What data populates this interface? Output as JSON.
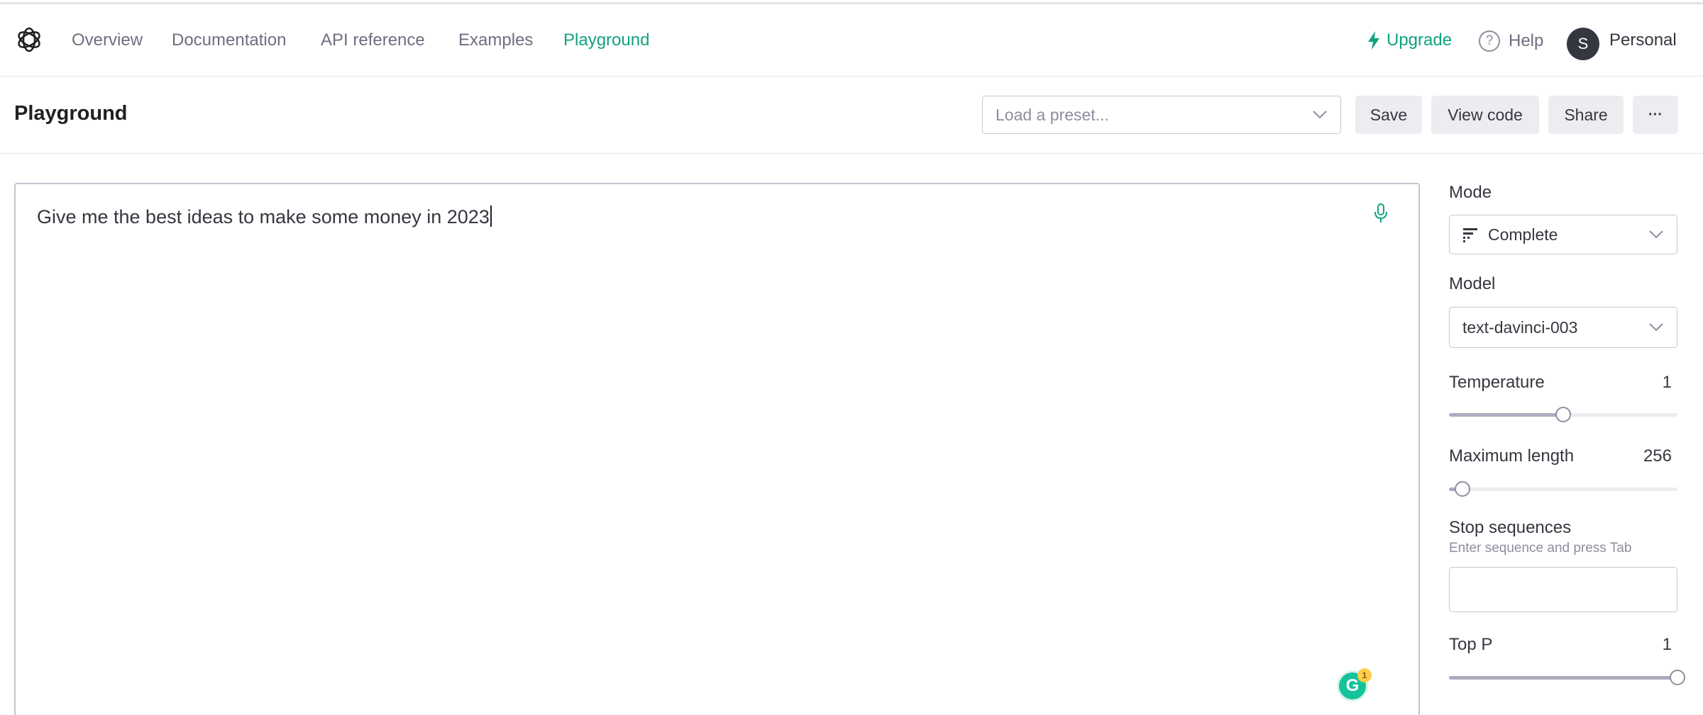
{
  "nav": {
    "links": [
      "Overview",
      "Documentation",
      "API reference",
      "Examples",
      "Playground"
    ],
    "upgrade": "Upgrade",
    "help_icon": "?",
    "help": "Help",
    "avatar_initial": "S",
    "account": "Personal",
    "accent_color": "#10a37f"
  },
  "header": {
    "title": "Playground",
    "preset_placeholder": "Load a preset...",
    "save": "Save",
    "view_code": "View code",
    "share": "Share",
    "more": "···"
  },
  "editor": {
    "prompt": "Give me the best ideas to make some money in 2023",
    "grammarly_letter": "G",
    "grammarly_count": "1"
  },
  "panel": {
    "mode_label": "Mode",
    "mode_value": "Complete",
    "model_label": "Model",
    "model_value": "text-davinci-003",
    "temperature_label": "Temperature",
    "temperature_value": "1",
    "temperature_fraction": 0.5,
    "max_length_label": "Maximum length",
    "max_length_value": "256",
    "max_length_fraction": 0.06,
    "stop_label": "Stop sequences",
    "stop_hint": "Enter sequence and press Tab",
    "top_p_label": "Top P",
    "top_p_value": "1",
    "top_p_fraction": 1.0
  }
}
